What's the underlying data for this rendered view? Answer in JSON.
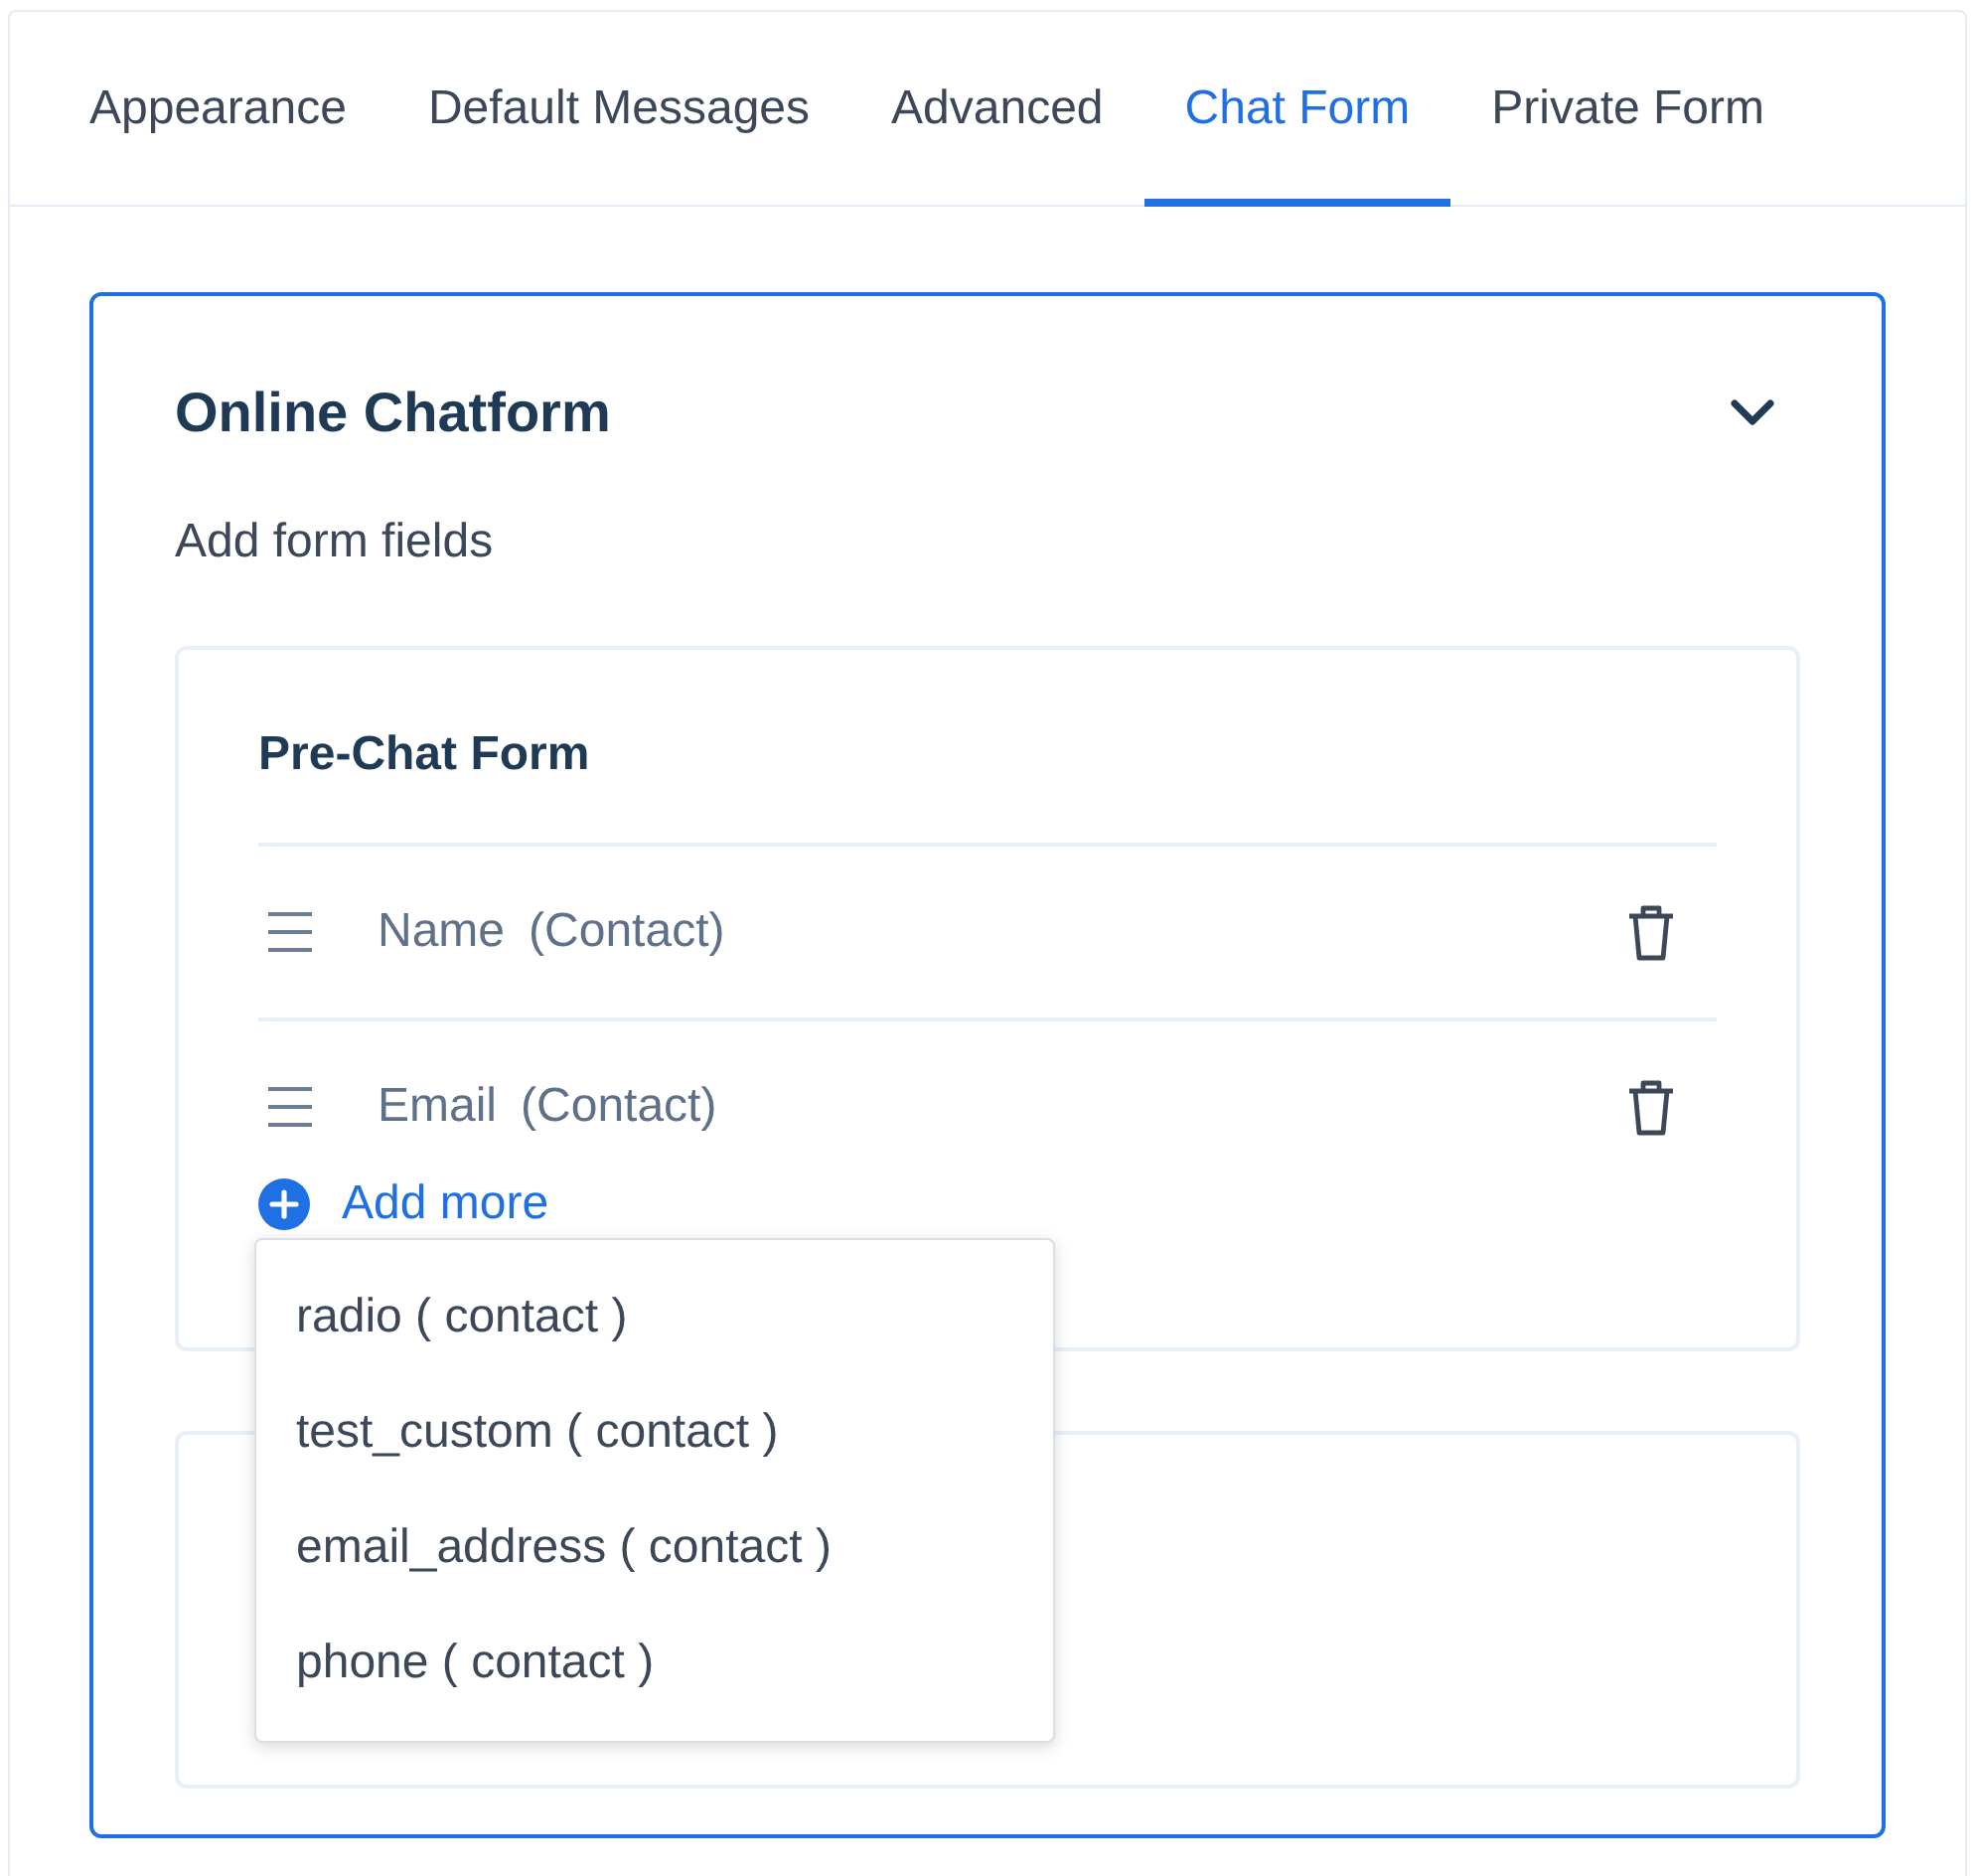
{
  "tabs": [
    {
      "label": "Appearance",
      "selected": false
    },
    {
      "label": "Default Messages",
      "selected": false
    },
    {
      "label": "Advanced",
      "selected": false
    },
    {
      "label": "Chat Form",
      "selected": true
    },
    {
      "label": "Private Form",
      "selected": false
    }
  ],
  "card": {
    "title": "Online Chatform",
    "expanded": true,
    "subtitle": "Add form fields",
    "form": {
      "title": "Pre-Chat Form",
      "fields": [
        {
          "name": "Name",
          "source": "(Contact)"
        },
        {
          "name": "Email",
          "source": "(Contact)"
        }
      ],
      "add_more": "Add more",
      "menu": [
        "radio ( contact )",
        "test_custom ( contact )",
        "email_address ( contact )",
        "phone ( contact )"
      ]
    }
  }
}
